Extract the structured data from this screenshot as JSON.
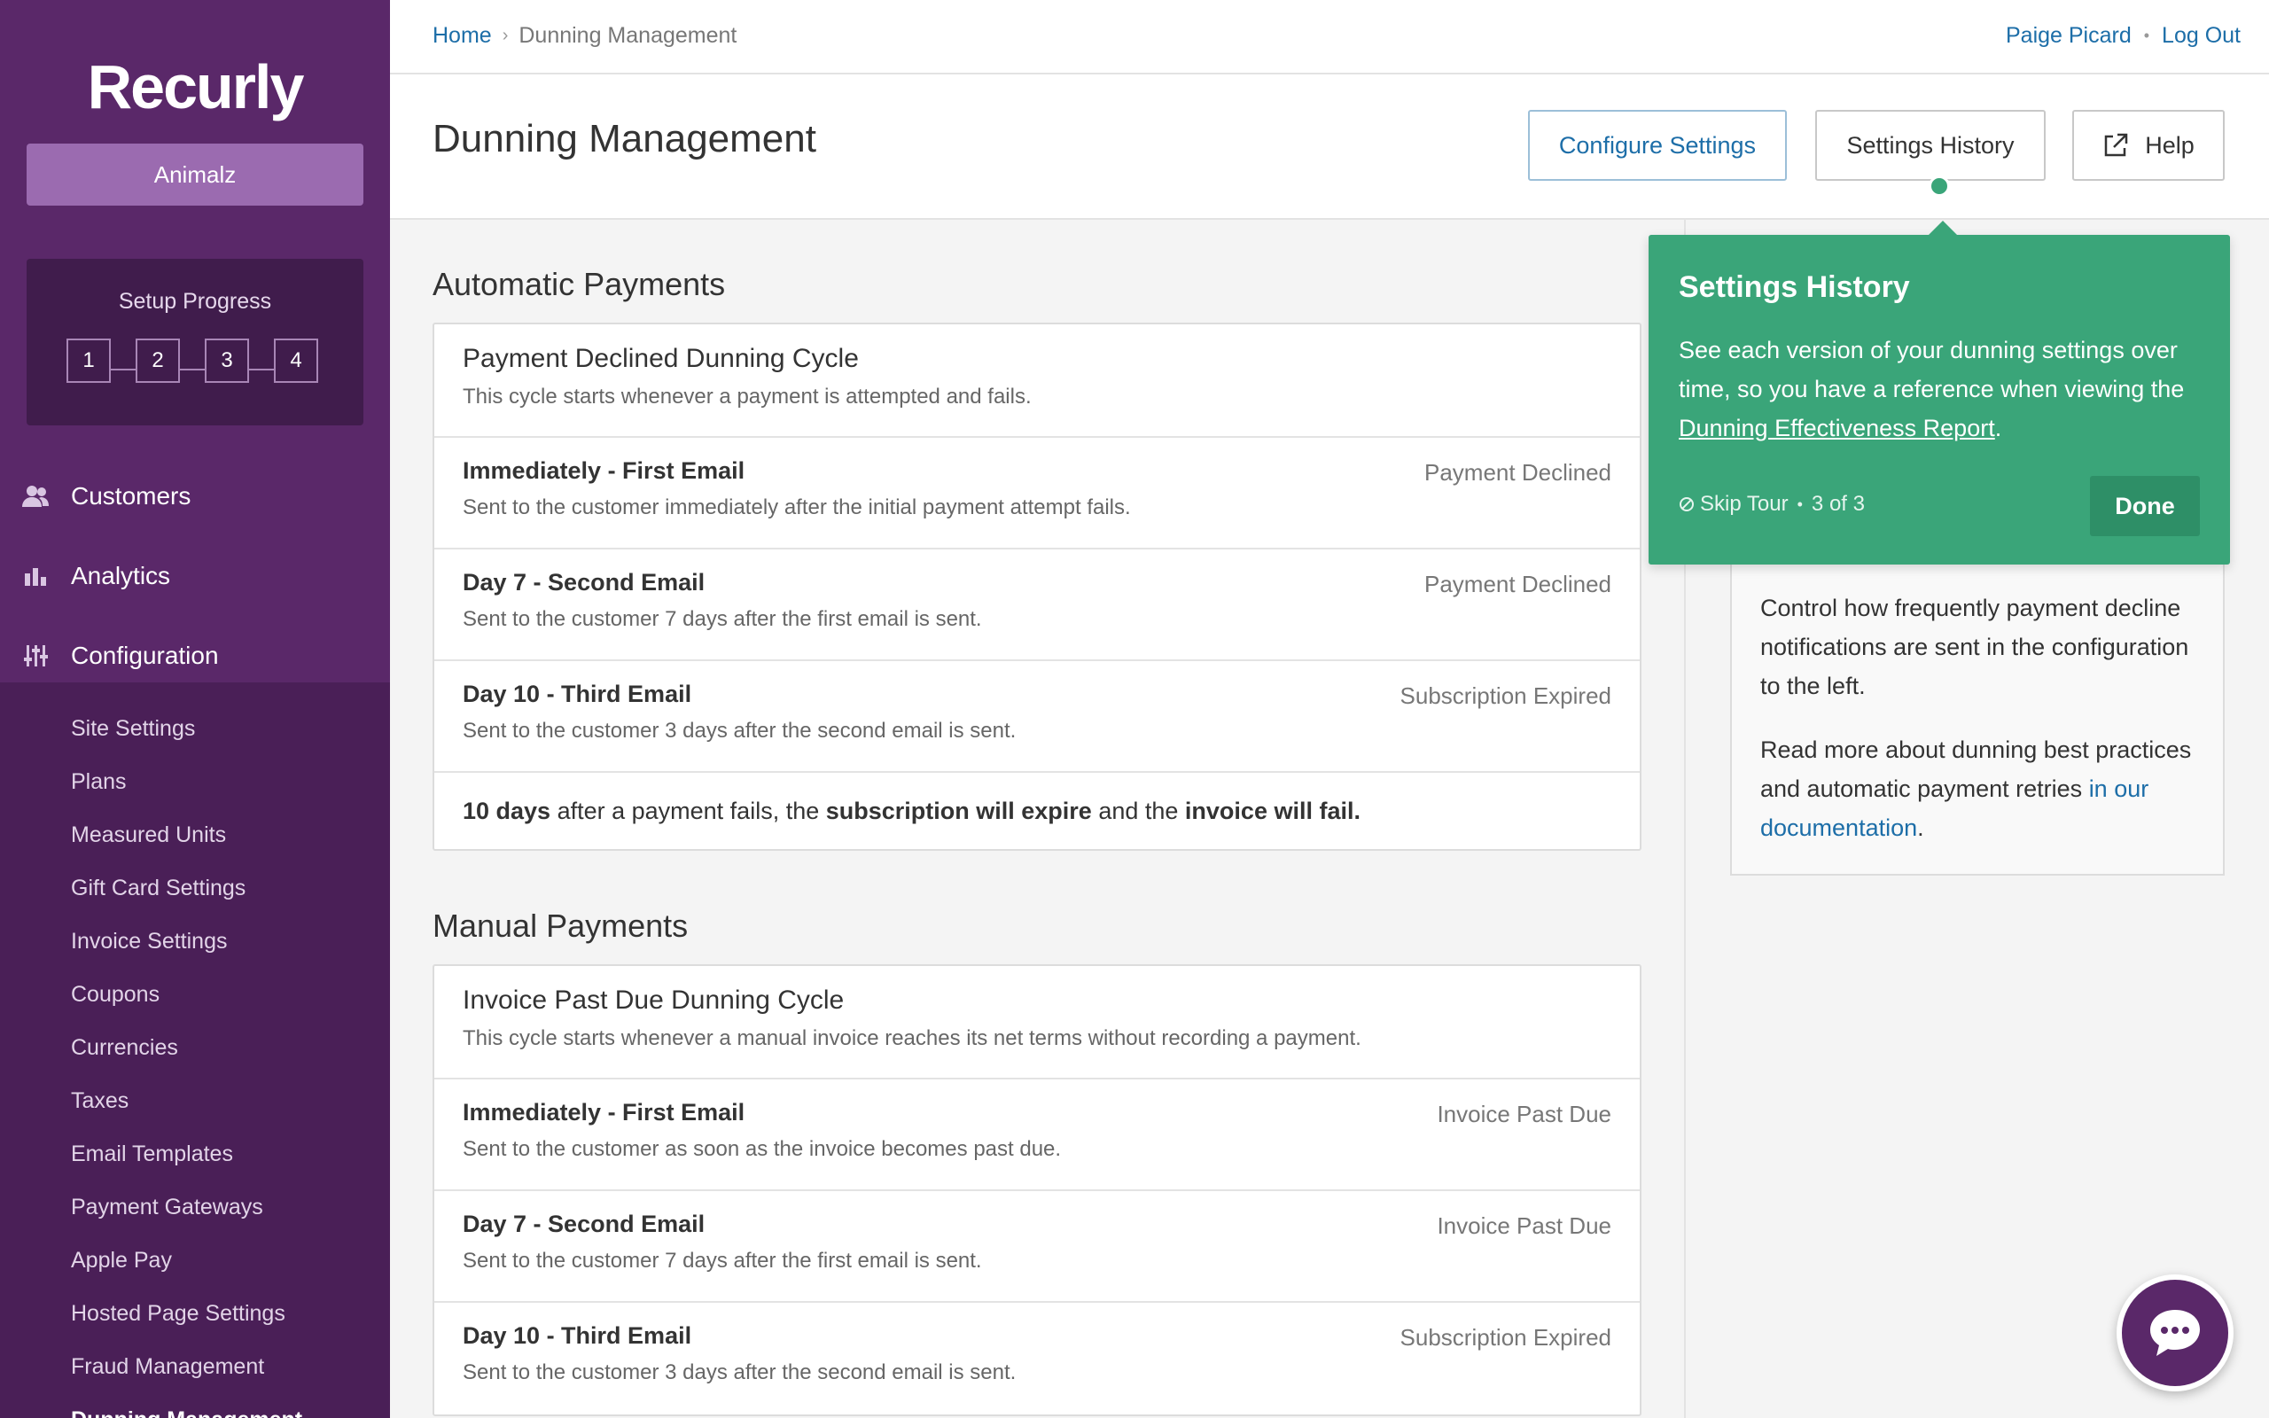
{
  "sidebar": {
    "logo": "Recurly",
    "account": "Animalz",
    "setup": {
      "title": "Setup Progress",
      "steps": [
        "1",
        "2",
        "3",
        "4"
      ]
    },
    "nav": [
      {
        "label": "Customers",
        "icon": "customers-icon"
      },
      {
        "label": "Analytics",
        "icon": "analytics-icon"
      },
      {
        "label": "Configuration",
        "icon": "configuration-icon"
      }
    ],
    "subnav": [
      "Site Settings",
      "Plans",
      "Measured Units",
      "Gift Card Settings",
      "Invoice Settings",
      "Coupons",
      "Currencies",
      "Taxes",
      "Email Templates",
      "Payment Gateways",
      "Apple Pay",
      "Hosted Page Settings",
      "Fraud Management",
      "Dunning Management"
    ]
  },
  "topbar": {
    "breadcrumb": {
      "home": "Home",
      "current": "Dunning Management"
    },
    "user": "Paige Picard",
    "logout": "Log Out"
  },
  "header": {
    "title": "Dunning Management",
    "configure": "Configure Settings",
    "history": "Settings History",
    "help": "Help"
  },
  "automatic": {
    "title": "Automatic Payments",
    "cycle_title": "Payment Declined Dunning Cycle",
    "cycle_desc": "This cycle starts whenever a payment is attempted and fails.",
    "rows": [
      {
        "title": "Immediately - First Email",
        "desc": "Sent to the customer immediately after the initial payment attempt fails.",
        "status": "Payment Declined"
      },
      {
        "title": "Day 7 - Second Email",
        "desc": "Sent to the customer 7 days after the first email is sent.",
        "status": "Payment Declined"
      },
      {
        "title": "Day 10 - Third Email",
        "desc": "Sent to the customer 3 days after the second email is sent.",
        "status": "Subscription Expired"
      }
    ],
    "summary": {
      "part1": "10 days",
      "part2": " after a payment fails, the ",
      "part3": "subscription will expire",
      "part4": " and the ",
      "part5": "invoice will fail."
    }
  },
  "manual": {
    "title": "Manual Payments",
    "cycle_title": "Invoice Past Due Dunning Cycle",
    "cycle_desc": "This cycle starts whenever a manual invoice reaches its net terms without recording a payment.",
    "rows": [
      {
        "title": "Immediately - First Email",
        "desc": "Sent to the customer as soon as the invoice becomes past due.",
        "status": "Invoice Past Due"
      },
      {
        "title": "Day 7 - Second Email",
        "desc": "Sent to the customer 7 days after the first email is sent.",
        "status": "Invoice Past Due"
      },
      {
        "title": "Day 10 - Third Email",
        "desc": "Sent to the customer 3 days after the second email is sent.",
        "status": "Subscription Expired"
      }
    ]
  },
  "info": {
    "p1": "Control how frequently payment decline notifications are sent in the configuration to the left.",
    "p2_text": "Read more about dunning best practices and automatic payment retries ",
    "p2_link": "in our documentation",
    "p2_end": "."
  },
  "tour": {
    "title": "Settings History",
    "body": "See each version of your dunning settings over time, so you have a reference when viewing the ",
    "link": "Dunning Effectiveness Report",
    "body_end": ".",
    "skip": "Skip Tour",
    "progress": "3 of 3",
    "done": "Done"
  },
  "colors": {
    "sidebar": "#5a2869",
    "accent_green": "#3aa579",
    "link_blue": "#1d6ea8"
  }
}
